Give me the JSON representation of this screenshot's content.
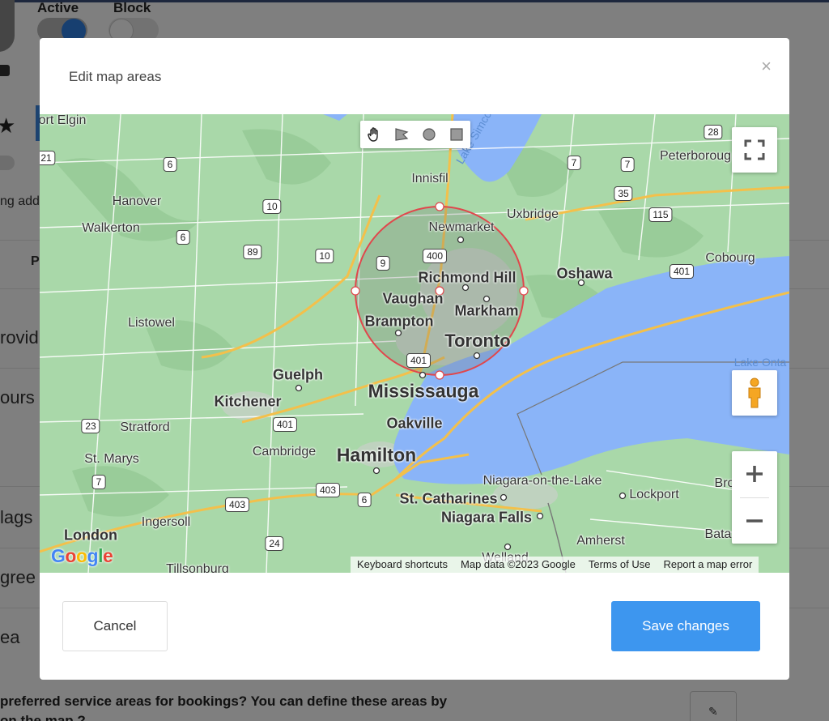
{
  "background": {
    "status_active_label": "Active",
    "status_block_label": "Block",
    "partial_texts": [
      "ng add",
      "P",
      "rovid",
      "ours",
      "lags",
      "gree",
      "ea"
    ],
    "question_line1": "preferred service areas for bookings? You can define these areas by",
    "question_line2": "on the map ?"
  },
  "modal": {
    "title": "Edit map areas",
    "close_symbol": "×",
    "cancel_label": "Cancel",
    "save_label": "Save changes"
  },
  "map": {
    "places": {
      "port_elgin": "ort Elgin",
      "hanover": "Hanover",
      "walkerton": "Walkerton",
      "listowel": "Listowel",
      "innisfil": "Innisfil",
      "newmarket": "Newmarket",
      "uxbridge": "Uxbridge",
      "peterborough": "Peterboroug",
      "richmond_hill": "Richmond Hill",
      "vaughan": "Vaughan",
      "markham": "Markham",
      "brampton": "Brampton",
      "toronto": "Toronto",
      "oshawa": "Oshawa",
      "cobourg": "Cobourg",
      "guelph": "Guelph",
      "kitchener": "Kitchener",
      "mississauga": "Mississauga",
      "oakville": "Oakville",
      "stratford": "Stratford",
      "cambridge": "Cambridge",
      "hamilton": "Hamilton",
      "st_marys": "St. Marys",
      "ingersoll": "Ingersoll",
      "london": "London",
      "tillsonburg": "Tillsonburg",
      "st_catharines": "St. Catharines",
      "niagara_falls": "Niagara Falls",
      "niagara_on_the_lake": "Niagara-on-the-Lake",
      "lockport": "Lockport",
      "amherst": "Amherst",
      "welland": "Welland",
      "bro": "Bro",
      "bata": "Bata",
      "lake_simcoe": "Lake Simcoe",
      "lake_ontario": "Lake Onta"
    },
    "routes": [
      "21",
      "6",
      "10",
      "6",
      "89",
      "10",
      "9",
      "400",
      "401",
      "7",
      "7",
      "35",
      "115",
      "28",
      "401",
      "23",
      "401",
      "7",
      "403",
      "403",
      "6",
      "24"
    ],
    "attribution": {
      "keyboard": "Keyboard shortcuts",
      "map_data": "Map data ©2023 Google",
      "terms": "Terms of Use",
      "report": "Report a map error"
    },
    "google_letters": [
      "G",
      "o",
      "o",
      "g",
      "l",
      "e"
    ],
    "colors": {
      "land": "#a9d8a9",
      "water": "#8ab4f8",
      "circle_stroke": "#e0474c",
      "save_button": "#3d96ef"
    }
  }
}
